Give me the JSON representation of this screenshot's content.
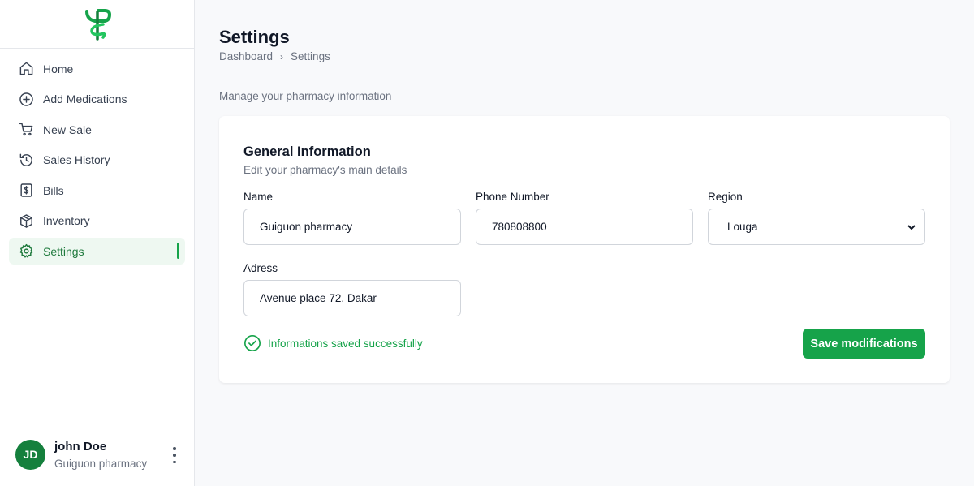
{
  "sidebar": {
    "items": [
      {
        "label": "Home",
        "icon": "home-icon"
      },
      {
        "label": "Add Medications",
        "icon": "plus-circle-icon"
      },
      {
        "label": "New Sale",
        "icon": "cart-icon"
      },
      {
        "label": "Sales History",
        "icon": "history-icon"
      },
      {
        "label": "Bills",
        "icon": "bill-icon"
      },
      {
        "label": "Inventory",
        "icon": "box-icon"
      },
      {
        "label": "Settings",
        "icon": "gear-icon"
      }
    ],
    "active_item": "Settings"
  },
  "user": {
    "initials": "JD",
    "name": "john Doe",
    "pharmacy": "Guiguon pharmacy"
  },
  "header": {
    "title": "Settings",
    "breadcrumb": [
      "Dashboard",
      "Settings"
    ],
    "description": "Manage your pharmacy information"
  },
  "card": {
    "title": "General Information",
    "subtitle": "Edit your pharmacy's main details",
    "fields": {
      "name": {
        "label": "Name",
        "value": "Guiguon pharmacy"
      },
      "phone": {
        "label": "Phone Number",
        "value": "780808800"
      },
      "region": {
        "label": "Region",
        "value": "Louga"
      },
      "address": {
        "label": "Adress",
        "value": "Avenue place 72, Dakar"
      }
    },
    "success_message": "Informations saved successfully",
    "save_label": "Save modifications"
  },
  "colors": {
    "accent": "#16a34a",
    "avatar": "#15803d",
    "active_bg": "#eef8f1"
  }
}
